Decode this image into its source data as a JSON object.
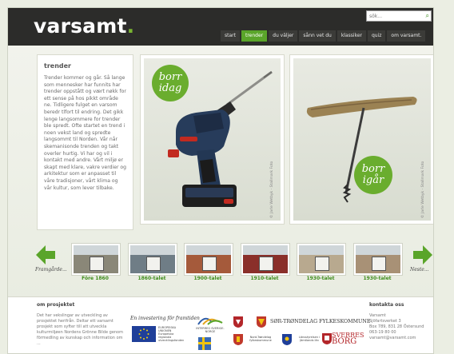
{
  "header": {
    "logo_text": "varsamt",
    "logo_dot": ".",
    "search_placeholder": "sök...",
    "nav": [
      {
        "label": "start",
        "active": false
      },
      {
        "label": "trender",
        "active": true
      },
      {
        "label": "du väljer",
        "active": false
      },
      {
        "label": "sånn vet du",
        "active": false
      },
      {
        "label": "klassiker",
        "active": false
      },
      {
        "label": "quiz",
        "active": false
      },
      {
        "label": "om varsamt.",
        "active": false
      }
    ]
  },
  "article": {
    "title": "trender",
    "body": "Trender kommer og går. Så lange som mennesker har funnits har trender oppstått og vært nøkk for ett sense på hos pikkt område ne. Tidligere fulget en varsom beredr tlfort til endring. Det gikk lenge langsommere for trender ble spredt. Ofte startet en trend i noen vekst land og spredte langsommt til Norden. Vår når skemanisonde trenden og takt overler hurtig. Vi har og vil i kontakt med andre. Vårt miljø er skapt med klare, vakre verdier og arkitektur som er anpasset til våre tradisjoner, vårt klima og vår kultur, som lever tilbake."
  },
  "photos": [
    {
      "badge_line1": "borr",
      "badge_line2": "idag",
      "credit": "© Jarle Wetbyk - Stallmark Foto"
    },
    {
      "badge_line1": "borr",
      "badge_line2": "igår",
      "credit": "© Jarle Wetbyk - Stallmark Foto"
    }
  ],
  "strip": {
    "prev_label": "Framgårde...",
    "next_label": "Neste...",
    "thumbs": [
      {
        "label": "Före 1860",
        "bg": "#8a8778"
      },
      {
        "label": "1860-talet",
        "bg": "#6f7d86"
      },
      {
        "label": "1900-talet",
        "bg": "#a55a3b"
      },
      {
        "label": "1910-talet",
        "bg": "#8a2f2a"
      },
      {
        "label": "1930-talet",
        "bg": "#b8a98f"
      },
      {
        "label": "1930-talet",
        "bg": "#a89176"
      }
    ]
  },
  "footer": {
    "about_title": "om prosjektet",
    "about_text": "Det har vekslingar av utveckling av prosjektet herifrån. Deltar ett varsamt prosjekt som syfter till att utveckla kulturmiljøen Nordens Grönne Bilde genom förmedling av kunskap och information om ...",
    "partners_title": "En investering för framtiden",
    "eu_text": "EUROPEISKA UNIONEN Europeiska regionala utvecklingsfonden",
    "interreg_text": "INTERREG SVERIGE-NORGE",
    "fylke_text": "SØR-TRØNDELAG FYLKESKOMMUNE",
    "logo_texts": [
      "Nord-Trøndelag fylkeskommune",
      "Länsstyrelsen i Jämtlands län"
    ],
    "sverres_line1": "SVERRES",
    "sverres_line2": "BORG",
    "contact_title": "kontakta oss",
    "contact_lines": [
      "Varsamt",
      "Sjöfartsverket 3",
      "Box 789, 831 28 Östersund",
      "063-19 80 00",
      "varsamt@varsamt.com"
    ]
  },
  "colors": {
    "accent": "#5aa52a",
    "header_bg": "#2c2c2a"
  }
}
